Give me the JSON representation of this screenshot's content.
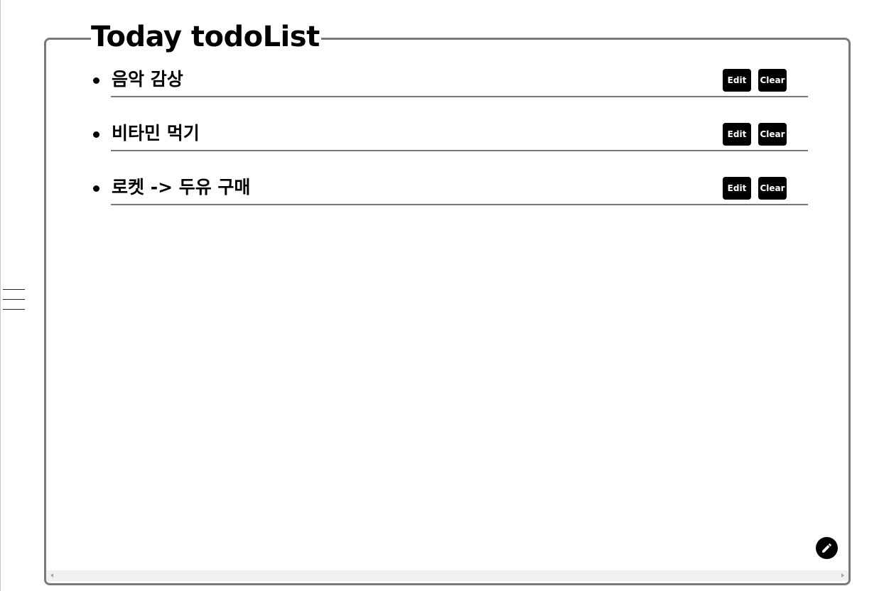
{
  "header": {
    "title": "Today todoList"
  },
  "todos": [
    {
      "text": "음악 감상",
      "edit_label": "Edit",
      "clear_label": "Clear"
    },
    {
      "text": "비타민 먹기",
      "edit_label": "Edit",
      "clear_label": "Clear"
    },
    {
      "text": "로켓 -> 두유 구매",
      "edit_label": "Edit",
      "clear_label": "Clear"
    }
  ],
  "icons": {
    "menu": "hamburger-menu-icon",
    "fab": "pencil-icon",
    "scroll_left": "scroll-left-arrow-icon",
    "scroll_right": "scroll-right-arrow-icon"
  },
  "colors": {
    "panel_border": "#7a7a7a",
    "button_bg": "#000000",
    "button_text": "#ffffff",
    "divider": "#777777"
  }
}
